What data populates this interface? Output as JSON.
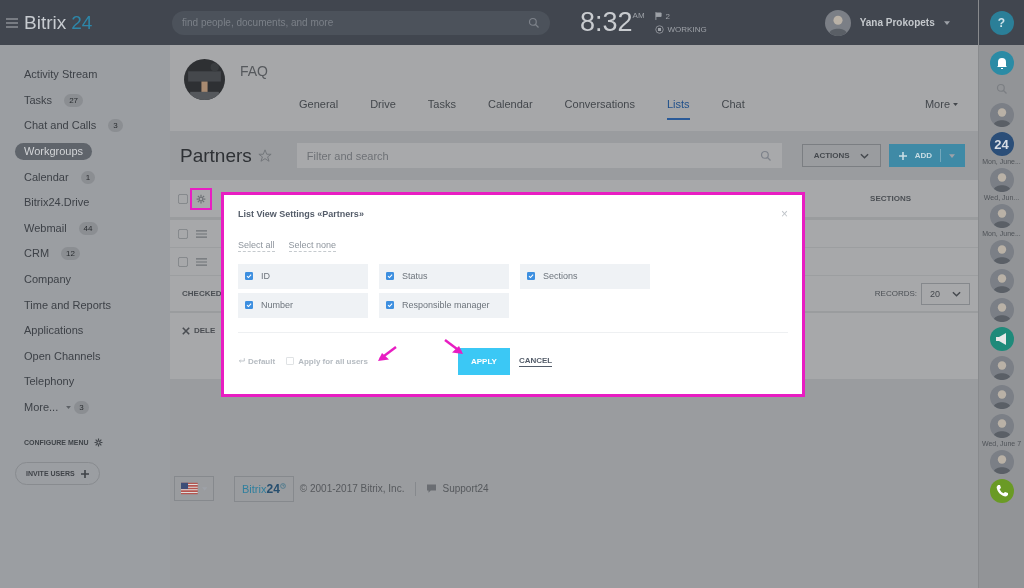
{
  "header": {
    "logo_word": "Bitrix",
    "logo_number": "24",
    "search": {
      "placeholder": "find people, documents, and more"
    },
    "clock": "8:32",
    "clock_suffix": "AM",
    "flag_count": "2",
    "work_status": "WORKING",
    "user_name": "Yana Prokopets"
  },
  "sidebar": {
    "items": [
      {
        "label": "Activity Stream",
        "selected": false
      },
      {
        "label": "Tasks",
        "count": "27",
        "selected": false
      },
      {
        "label": "Chat and Calls",
        "count": "3",
        "selected": false
      },
      {
        "label": "Workgroups",
        "selected": true
      },
      {
        "label": "Calendar",
        "count": "1",
        "selected": false
      },
      {
        "label": "Bitrix24.Drive",
        "selected": false
      },
      {
        "label": "Webmail",
        "count": "44",
        "selected": false
      },
      {
        "label": "CRM",
        "count": "12",
        "selected": false
      },
      {
        "label": "Company",
        "selected": false
      },
      {
        "label": "Time and Reports",
        "selected": false
      },
      {
        "label": "Applications",
        "selected": false
      },
      {
        "label": "Open Channels",
        "selected": false
      },
      {
        "label": "Telephony",
        "selected": false
      },
      {
        "label": "More...",
        "count": "3",
        "kind": "more",
        "selected": false
      }
    ],
    "configure_menu": "CONFIGURE MENU",
    "invite_users": "INVITE USERS"
  },
  "group": {
    "name": "FAQ",
    "tabs": [
      {
        "label": "General",
        "selected": false
      },
      {
        "label": "Drive",
        "selected": false
      },
      {
        "label": "Tasks",
        "selected": false
      },
      {
        "label": "Calendar",
        "selected": false
      },
      {
        "label": "Conversations",
        "selected": false
      },
      {
        "label": "Lists",
        "selected": true
      },
      {
        "label": "Chat",
        "selected": false
      }
    ],
    "more": "More"
  },
  "list": {
    "title": "Partners",
    "filter": {
      "placeholder": "Filter and search"
    },
    "actions_button": "ACTIONS",
    "add_button": "ADD",
    "header_checkbox": {
      "checked": false
    },
    "columns": [
      "SECTIONS"
    ],
    "row_count_checkboxes": [
      {
        "checked": false
      },
      {
        "checked": false
      }
    ],
    "checked_label": "CHECKED",
    "delete_label": "DELE",
    "records_label": "RECORDS:",
    "records_value": "20"
  },
  "dialog": {
    "title": "List View Settings «Partners»",
    "select_all": "Select all",
    "select_none": "Select none",
    "fields": [
      {
        "label": "ID",
        "checked": true
      },
      {
        "label": "Status",
        "checked": true
      },
      {
        "label": "Sections",
        "checked": true
      },
      {
        "label": "Number",
        "checked": true
      },
      {
        "label": "Responsible manager",
        "checked": true
      }
    ],
    "default": "Default",
    "apply_all": {
      "label": "Apply for all users",
      "checked": false
    },
    "apply": "APPLY",
    "cancel": "CANCEL",
    "close": "×"
  },
  "footer": {
    "logo_word": "Bitrix",
    "logo_number": "24",
    "copyright": "© 2001-2017 Bitrix, Inc.",
    "support": "Support24"
  },
  "rail": [
    {
      "kind": "help",
      "label": "?"
    },
    {
      "kind": "bell"
    },
    {
      "kind": "search"
    },
    {
      "kind": "avatar"
    },
    {
      "kind": "logo",
      "label": "24"
    },
    {
      "kind": "date",
      "label": "Mon, June..."
    },
    {
      "kind": "avatar"
    },
    {
      "kind": "date",
      "label": "Wed, Jun..."
    },
    {
      "kind": "avatar"
    },
    {
      "kind": "date",
      "label": "Mon, June..."
    },
    {
      "kind": "avatar"
    },
    {
      "kind": "avatar"
    },
    {
      "kind": "avatar"
    },
    {
      "kind": "megaphone"
    },
    {
      "kind": "avatar"
    },
    {
      "kind": "avatar"
    },
    {
      "kind": "avatar"
    },
    {
      "kind": "date",
      "label": "Wed, June 7"
    },
    {
      "kind": "avatar"
    },
    {
      "kind": "phone"
    }
  ]
}
